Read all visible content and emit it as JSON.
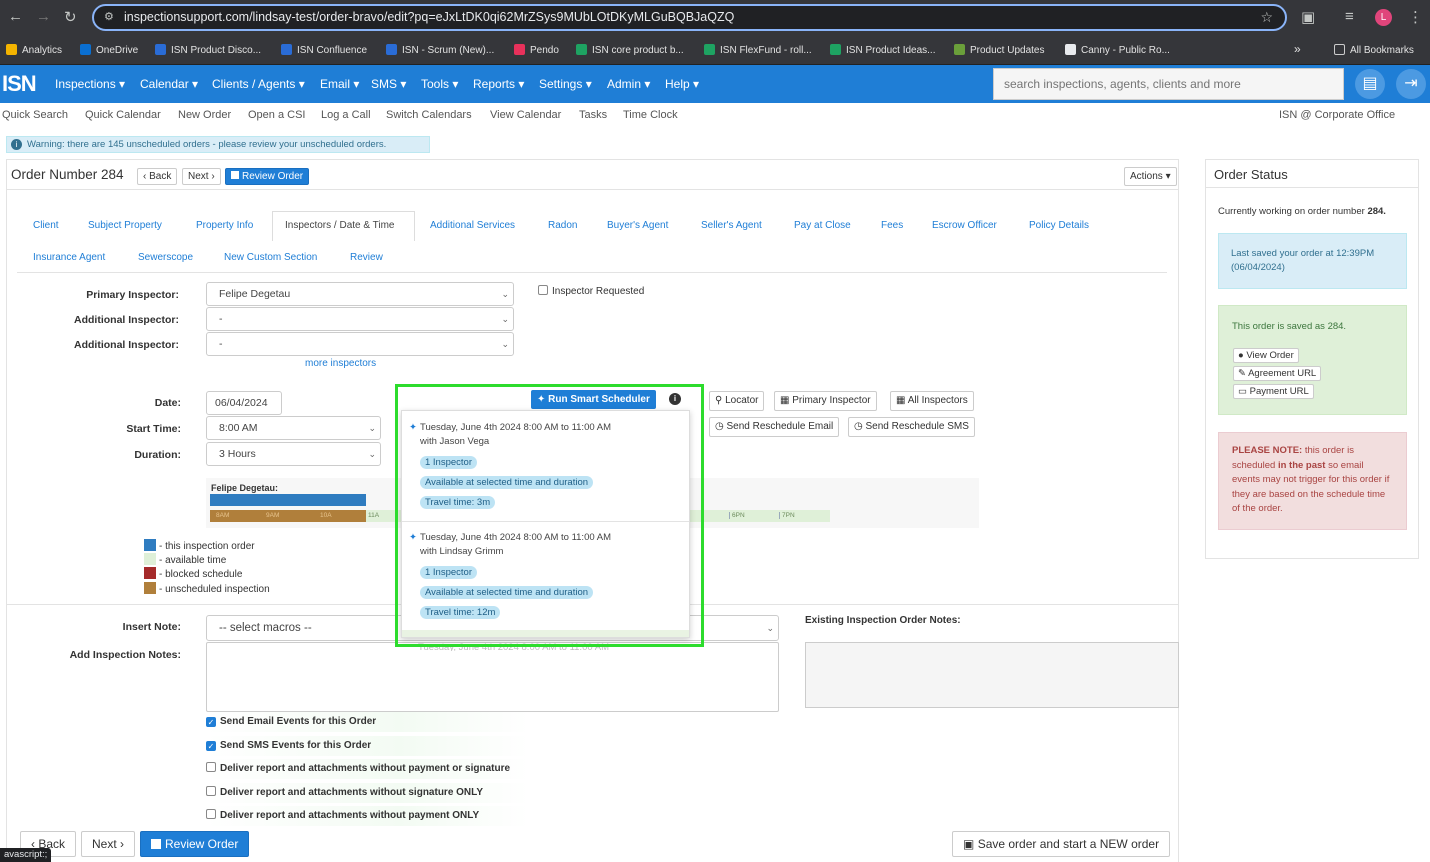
{
  "browser": {
    "url": "inspectionsupport.com/lindsay-test/order-bravo/edit?pq=eJxLtDK0qi62MrZSys9MUbLOtDKyMLGuBQBJaQZQ",
    "avatar_letter": "L"
  },
  "bookmarks": [
    "Analytics",
    "OneDrive",
    "ISN Product Disco...",
    "ISN Confluence",
    "ISN - Scrum (New)...",
    "Pendo",
    "ISN core product b...",
    "ISN FlexFund - roll...",
    "ISN Product Ideas...",
    "Product Updates",
    "Canny - Public Ro..."
  ],
  "all_bookmarks": "All Bookmarks",
  "bookmark_more": "»",
  "nav": {
    "logo": "ISN",
    "items": [
      "Inspections ▾",
      "Calendar ▾",
      "Clients / Agents ▾",
      "Email ▾",
      "SMS ▾",
      "Tools ▾",
      "Reports ▾",
      "Settings ▾",
      "Admin ▾",
      "Help ▾"
    ],
    "search_placeholder": "search inspections, agents, clients and more"
  },
  "subnav": {
    "items": [
      "Quick Search",
      "Quick Calendar",
      "New Order",
      "Open a CSI",
      "Log a Call",
      "Switch Calendars",
      "View Calendar",
      "Tasks",
      "Time Clock"
    ],
    "office": "ISN @ Corporate Office"
  },
  "warning": "Warning: there are 145 unscheduled orders - please review your unscheduled orders.",
  "order": {
    "title": "Order Number 284",
    "back": "‹ Back",
    "next": "Next ›",
    "review": "Review Order",
    "actions": "Actions ▾"
  },
  "tabs_row1": [
    "Client",
    "Subject Property",
    "Property Info",
    "Inspectors / Date & Time",
    "Additional Services",
    "Radon",
    "Buyer's Agent",
    "Seller's Agent",
    "Pay at Close",
    "Fees",
    "Escrow Officer",
    "Policy Details"
  ],
  "tabs_row2": [
    "Insurance Agent",
    "Sewerscope",
    "New Custom Section",
    "Review"
  ],
  "form": {
    "primary_label": "Primary Inspector:",
    "primary_value": "Felipe Degetau",
    "additional_label": "Additional Inspector:",
    "additional_value": "-",
    "more_inspectors": "more inspectors",
    "inspector_requested": "Inspector Requested",
    "date_label": "Date:",
    "date_value": "06/04/2024",
    "start_label": "Start Time:",
    "start_value": "8:00 AM",
    "duration_label": "Duration:",
    "duration_value": "3 Hours"
  },
  "scheduler": {
    "run": "Run Smart Scheduler",
    "locator": "Locator",
    "primary": "Primary Inspector",
    "all": "All Inspectors",
    "email": "Send Reschedule Email",
    "sms": "Send Reschedule SMS",
    "inspector_name": "Felipe Degetau:",
    "time_labels": [
      "8AM",
      "9AM",
      "10A",
      "11A",
      "6PN",
      "7PN"
    ],
    "results": [
      {
        "title": "Tuesday, June 4th 2024 8:00 AM to 11:00 AM",
        "with": "with Jason Vega",
        "pills": [
          "1 Inspector",
          "Available at selected time and duration",
          "Travel time: 3m"
        ]
      },
      {
        "title": "Tuesday, June 4th 2024 8:00 AM to 11:00 AM",
        "with": "with Lindsay Grimm",
        "pills": [
          "1 Inspector",
          "Available at selected time and duration",
          "Travel time: 12m"
        ]
      },
      {
        "title": "Tuesday, June 4th 2024 8:00 AM to 11:00 AM",
        "with": "",
        "pills": []
      }
    ]
  },
  "legend": [
    "- this inspection order",
    "- available time",
    "- blocked schedule",
    "- unscheduled inspection"
  ],
  "notes": {
    "insert_label": "Insert Note:",
    "macros": "-- select macros --",
    "add_label": "Add Inspection Notes:",
    "existing_label": "Existing Inspection Order Notes:"
  },
  "checkboxes": [
    {
      "label": "Send Email Events for this Order",
      "checked": true
    },
    {
      "label": "Send SMS Events for this Order",
      "checked": true
    },
    {
      "label": "Deliver report and attachments without payment or signature",
      "checked": false
    },
    {
      "label": "Deliver report and attachments without signature ONLY",
      "checked": false
    },
    {
      "label": "Deliver report and attachments without payment ONLY",
      "checked": false
    }
  ],
  "footer": {
    "back": "‹ Back",
    "next": "Next ›",
    "review": "Review Order",
    "save_new": "Save order and start a NEW order",
    "status_bar": "avascript:;"
  },
  "status": {
    "title": "Order Status",
    "working": "Currently working on order number",
    "number": "284.",
    "saved": "Last saved your order at 12:39PM (06/04/2024)",
    "saved_as": "This order is saved as 284.",
    "view": "View Order",
    "agreement": "Agreement URL",
    "payment": "Payment URL",
    "note_label": "PLEASE NOTE:",
    "note_1": " this order is scheduled ",
    "note_bold": "in the past",
    "note_2": " so email events may not trigger for this order if they are based on the schedule time of the order."
  },
  "colors": {
    "accent": "#1f7ed6",
    "highlight": "#2ddc2d",
    "order_block": "#2f7cc0",
    "blocked": "#a52a2a",
    "unscheduled": "#b07f3b",
    "available": "#dff0d8"
  }
}
